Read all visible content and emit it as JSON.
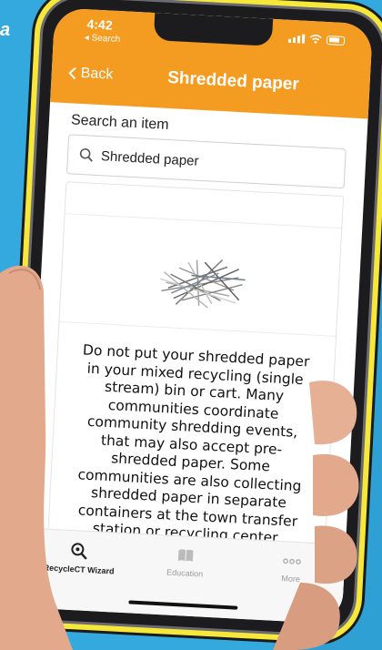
{
  "status": {
    "time": "4:42",
    "back_app": "◂ Search"
  },
  "nav": {
    "back_label": "Back",
    "title": "Shredded paper"
  },
  "search": {
    "label": "Search an item",
    "value": "Shredded paper"
  },
  "item": {
    "description": "Do not put your shredded paper in your mixed recycling (single stream) bin or cart. Many communities coordinate community shredding events, that may also accept pre-shredded paper.  Some communities are also collecting shredded paper in separate containers at the town transfer station or recycling center."
  },
  "tabs": [
    {
      "label": "RecycleCT Wizard",
      "icon": "search-magnifier-icon",
      "active": true
    },
    {
      "label": "Education",
      "icon": "book-icon",
      "active": false
    },
    {
      "label": "More",
      "icon": "more-dots-icon",
      "active": false
    }
  ],
  "colors": {
    "accent": "#f39c21",
    "background": "#33a9dd",
    "phone_outline": "#f6e83a"
  }
}
